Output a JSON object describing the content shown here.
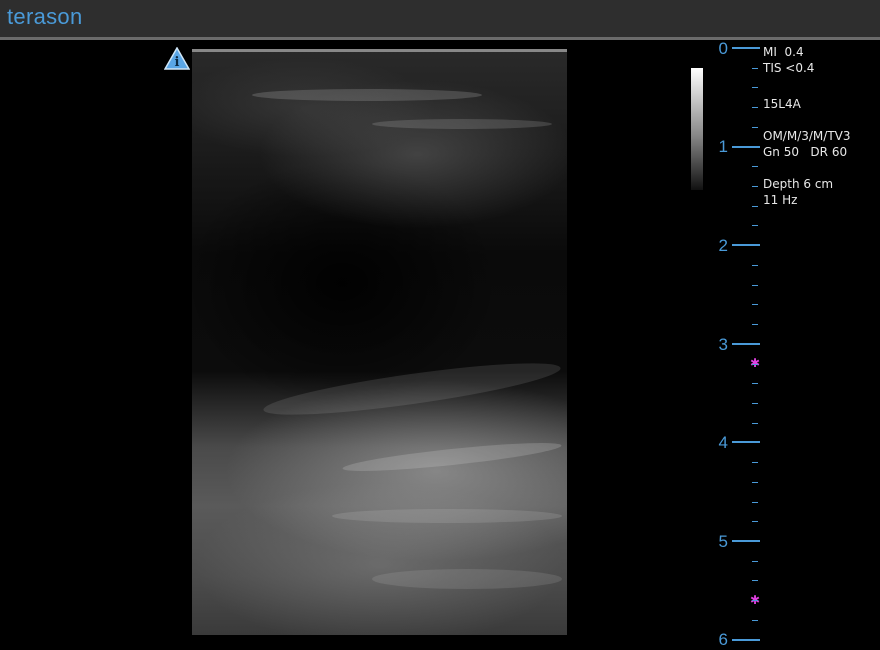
{
  "app": {
    "logo_text": "terason",
    "brand_color": "#4a9ad8"
  },
  "info_icon": {
    "name": "info-icon",
    "glyph": "i"
  },
  "parameters": {
    "mi": "MI  0.4",
    "tis": "TIS <0.4",
    "probe": "15L4A",
    "mode": "OM/M/3/M/TV3",
    "gain_dr": "Gn 50   DR 60",
    "depth": "Depth 6 cm",
    "frame_rate": "11 Hz"
  },
  "depth_scale": {
    "labels": [
      "0",
      "1",
      "2",
      "3",
      "4",
      "5",
      "6"
    ],
    "color": "#4a9ad8",
    "focus_marker_glyph": "✱",
    "focus_marker_color": "#e040e0",
    "focus_depths_cm": [
      3.2,
      5.6
    ]
  }
}
